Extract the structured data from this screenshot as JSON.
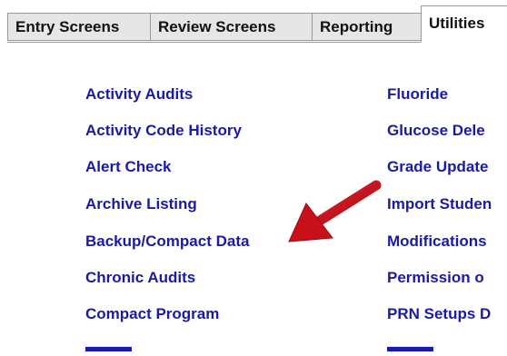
{
  "tabs": [
    {
      "label": "Entry Screens",
      "active": false
    },
    {
      "label": "Review Screens",
      "active": false
    },
    {
      "label": "Reporting",
      "active": false
    },
    {
      "label": "Utilities",
      "active": true
    }
  ],
  "left_links": [
    "Activity Audits",
    "Activity Code History",
    "Alert Check",
    "Archive Listing",
    "Backup/Compact Data",
    "Chronic Audits",
    "Compact Program"
  ],
  "right_links": [
    "Fluoride",
    "Glucose Dele",
    "Grade Update",
    "Import Studen",
    "Modifications",
    "Permission o",
    "PRN Setups D"
  ],
  "annotation": {
    "icon": "red-arrow-pointer",
    "color": "#c8101a",
    "points_to": "Backup/Compact Data"
  },
  "colors": {
    "link": "#1a1aa6",
    "tab_inactive_bg": "#e6e6e6",
    "tab_border": "#9a9a9a"
  }
}
